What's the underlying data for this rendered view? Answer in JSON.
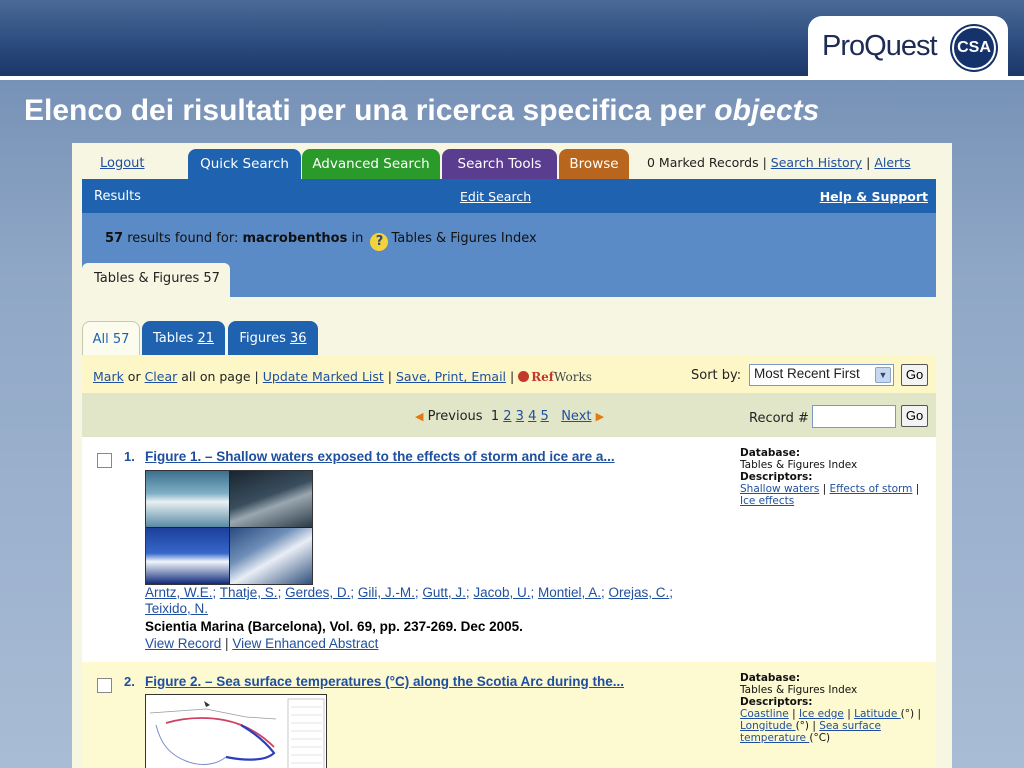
{
  "slide": {
    "title_main": "Elenco dei risultati per una ricerca specifica per ",
    "title_em": "objects",
    "logo_left": "Pro",
    "logo_q": "Q",
    "logo_right": "uest",
    "logo_badge": "CSA"
  },
  "nav": {
    "logout": "Logout",
    "tabs": [
      "Quick Search",
      "Advanced Search",
      "Search Tools",
      "Browse"
    ],
    "marked": "0 Marked Records",
    "sep": " | ",
    "search_history": "Search History",
    "alerts": "Alerts"
  },
  "results_bar": {
    "label": "Results",
    "edit_search": "Edit Search",
    "help": "Help & Support"
  },
  "found": {
    "count": "57",
    "text1": " results found for: ",
    "term": "macrobenthos",
    "text2": " in ",
    "help_glyph": "?",
    "index": "Tables & Figures Index"
  },
  "tf_tab": "Tables & Figures 57",
  "subtabs": {
    "all": "All 57",
    "tables_label": "Tables ",
    "tables_count": "21",
    "figures_label": "Figures ",
    "figures_count": "36"
  },
  "markbar": {
    "mark": "Mark",
    "or": " or ",
    "clear": "Clear",
    "on_page": " all on page | ",
    "update": "Update Marked List",
    "sep": " | ",
    "save": "Save, Print, Email",
    "ref_r": "Ref",
    "ref_w": "Works",
    "sort_label": "Sort by:",
    "sort_value": "Most Recent First",
    "go": "Go"
  },
  "pager": {
    "previous": "Previous",
    "current": "1",
    "pages": [
      "2",
      "3",
      "4",
      "5"
    ],
    "next": "Next",
    "record_label": "Record #",
    "go": "Go"
  },
  "records": [
    {
      "num": "1.",
      "title": "Figure 1. – Shallow waters exposed to the effects of storm and ice are a...",
      "authors": [
        "Arntz, W.E.",
        "Thatje, S.",
        "Gerdes, D.",
        "Gili, J.-M.",
        "Gutt, J.",
        "Jacob, U.",
        "Montiel, A.",
        "Orejas, C.",
        "Teixido, N."
      ],
      "journal": "Scientia Marina (Barcelona), Vol. 69, pp. 237-269. Dec 2005.",
      "view_record": "View Record",
      "view_abstract": "View Enhanced Abstract",
      "database_label": "Database:",
      "database": "Tables & Figures Index",
      "descriptors_label": "Descriptors:",
      "descriptors": [
        "Shallow waters",
        "Effects of storm",
        "Ice effects"
      ]
    },
    {
      "num": "2.",
      "title": "Figure 2. – Sea surface temperatures (°C) along the Scotia Arc during the...",
      "database_label": "Database:",
      "database": "Tables & Figures Index",
      "descriptors_label": "Descriptors:",
      "descriptors": [
        "Coastline",
        "Ice edge",
        "Latitude ",
        "Longitude ",
        "Sea surface temperature "
      ],
      "descriptor_suffixes": [
        "(°)",
        "(°)",
        "(°C)"
      ]
    }
  ],
  "colors": {
    "quick_search": "#1f63b0",
    "advanced_search": "#2a9a2a",
    "search_tools": "#5a3d8f",
    "browse": "#b8651e"
  }
}
